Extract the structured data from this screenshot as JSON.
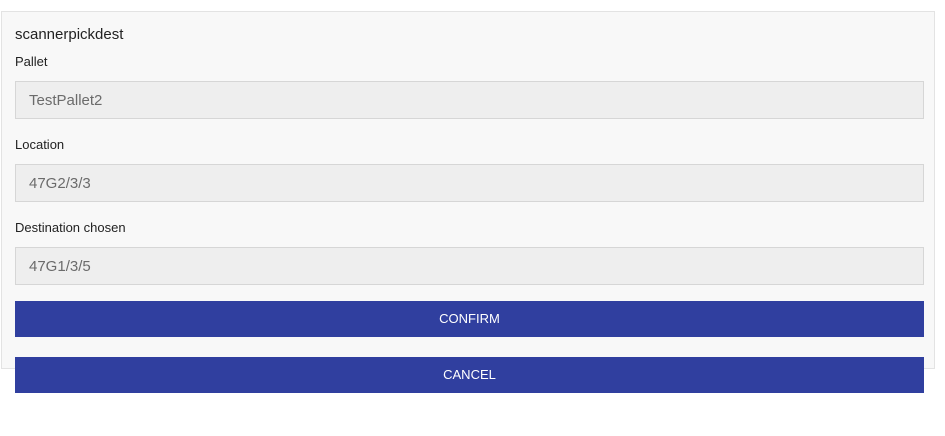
{
  "form": {
    "title": "scannerpickdest",
    "fields": [
      {
        "label": "Pallet",
        "value": "TestPallet2"
      },
      {
        "label": "Location",
        "value": "47G2/3/3"
      },
      {
        "label": "Destination chosen",
        "value": "47G1/3/5"
      }
    ],
    "confirm_label": "CONFIRM",
    "cancel_label": "CANCEL"
  },
  "colors": {
    "button": "#303f9f",
    "panel": "#f8f8f8",
    "input": "#eeeeee"
  }
}
